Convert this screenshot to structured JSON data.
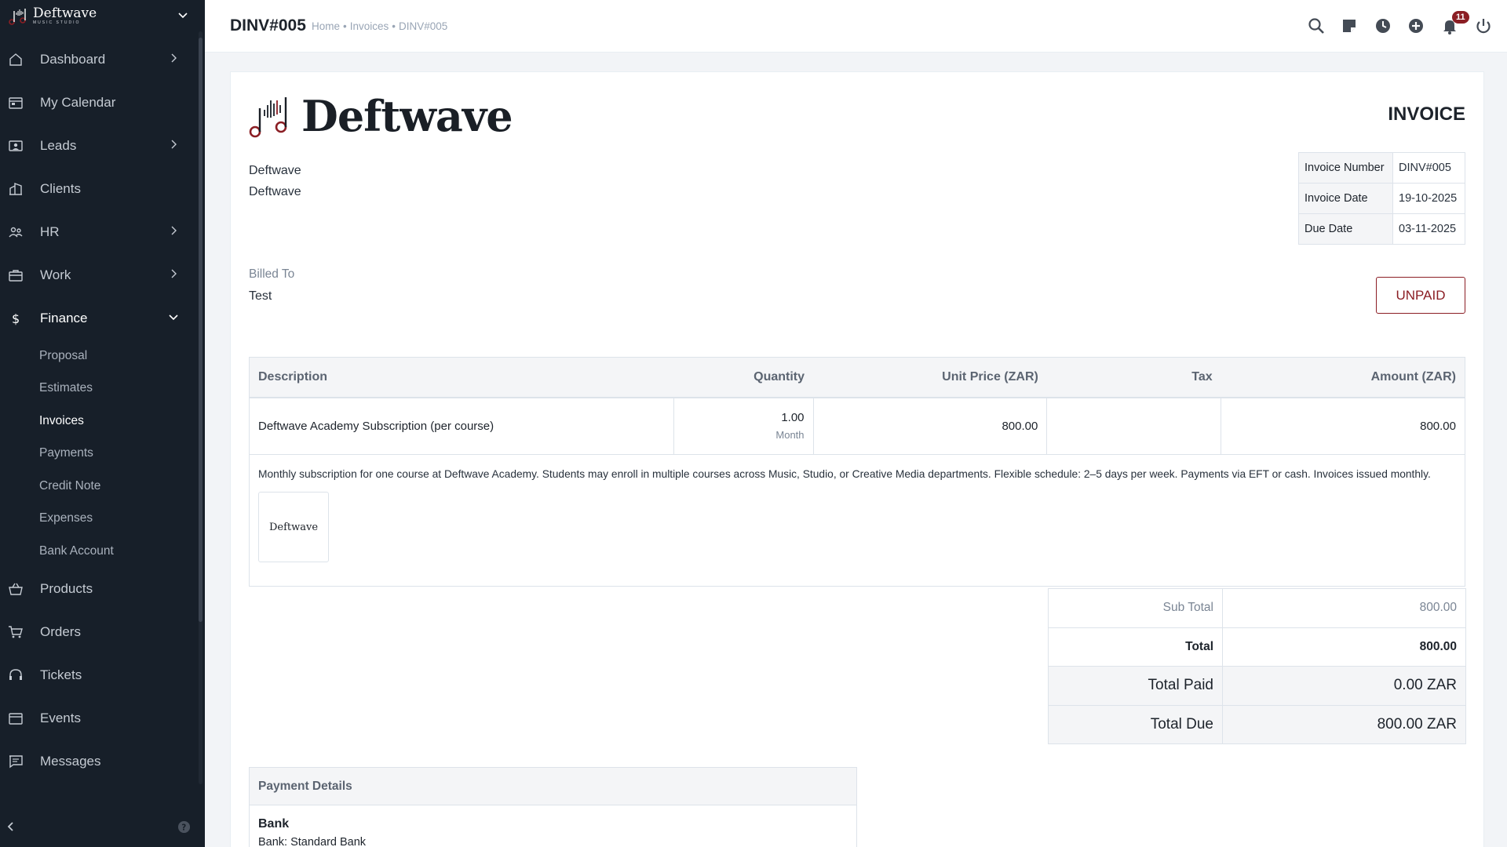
{
  "brand": {
    "name": "Deftwave",
    "subtitle": "MUSIC STUDIO"
  },
  "sidebar": {
    "items": [
      {
        "label": "Dashboard",
        "icon": "home-icon",
        "has_children": true
      },
      {
        "label": "My Calendar",
        "icon": "calendar-icon",
        "has_children": false
      },
      {
        "label": "Leads",
        "icon": "leads-icon",
        "has_children": true
      },
      {
        "label": "Clients",
        "icon": "building-icon",
        "has_children": false
      },
      {
        "label": "HR",
        "icon": "people-icon",
        "has_children": true
      },
      {
        "label": "Work",
        "icon": "briefcase-icon",
        "has_children": true
      },
      {
        "label": "Finance",
        "icon": "dollar-icon",
        "has_children": true,
        "expanded": true
      },
      {
        "label": "Products",
        "icon": "basket-icon",
        "has_children": false
      },
      {
        "label": "Orders",
        "icon": "cart-icon",
        "has_children": false
      },
      {
        "label": "Tickets",
        "icon": "headset-icon",
        "has_children": false
      },
      {
        "label": "Events",
        "icon": "calendar-event-icon",
        "has_children": false
      },
      {
        "label": "Messages",
        "icon": "chat-icon",
        "has_children": false
      }
    ],
    "finance_children": [
      "Proposal",
      "Estimates",
      "Invoices",
      "Payments",
      "Credit Note",
      "Expenses",
      "Bank Account"
    ],
    "current_child": "Invoices"
  },
  "header": {
    "title": "DINV#005",
    "breadcrumb": [
      "Home",
      "Invoices",
      "DINV#005"
    ],
    "notification_count": "11"
  },
  "invoice": {
    "logo_word": "Deftwave",
    "heading": "INVOICE",
    "company_lines": [
      "Deftwave",
      "Deftwave"
    ],
    "meta": [
      {
        "label": "Invoice Number",
        "value": "DINV#005"
      },
      {
        "label": "Invoice Date",
        "value": "19-10-2025"
      },
      {
        "label": "Due Date",
        "value": "03-11-2025"
      }
    ],
    "billed_to_label": "Billed To",
    "billed_to": "Test",
    "status": "UNPAID",
    "columns": [
      "Description",
      "Quantity",
      "Unit Price (ZAR)",
      "Tax",
      "Amount (ZAR)"
    ],
    "item": {
      "name": "Deftwave Academy Subscription (per course)",
      "quantity": "1.00",
      "unit": "Month",
      "unit_price": "800.00",
      "tax": "",
      "amount": "800.00",
      "description": "Monthly subscription for one course at Deftwave Academy. Students may enroll in multiple courses across Music, Studio, or Creative Media departments. Flexible schedule: 2–5 days per week. Payments via EFT or cash. Invoices issued monthly.",
      "thumb_text": "Deftwave"
    },
    "totals": [
      {
        "label": "Sub Total",
        "value": "800.00"
      },
      {
        "label": "Total",
        "value": "800.00"
      },
      {
        "label": "Total Paid",
        "value": "0.00 ZAR"
      },
      {
        "label": "Total Due",
        "value": "800.00 ZAR"
      }
    ],
    "payment": {
      "heading": "Payment Details",
      "bank_title": "Bank",
      "bank_line": "Bank: Standard Bank"
    }
  },
  "colors": {
    "sidebar_bg": "#171f29",
    "accent": "#8b1e24",
    "page_bg": "#f2f4f7"
  }
}
